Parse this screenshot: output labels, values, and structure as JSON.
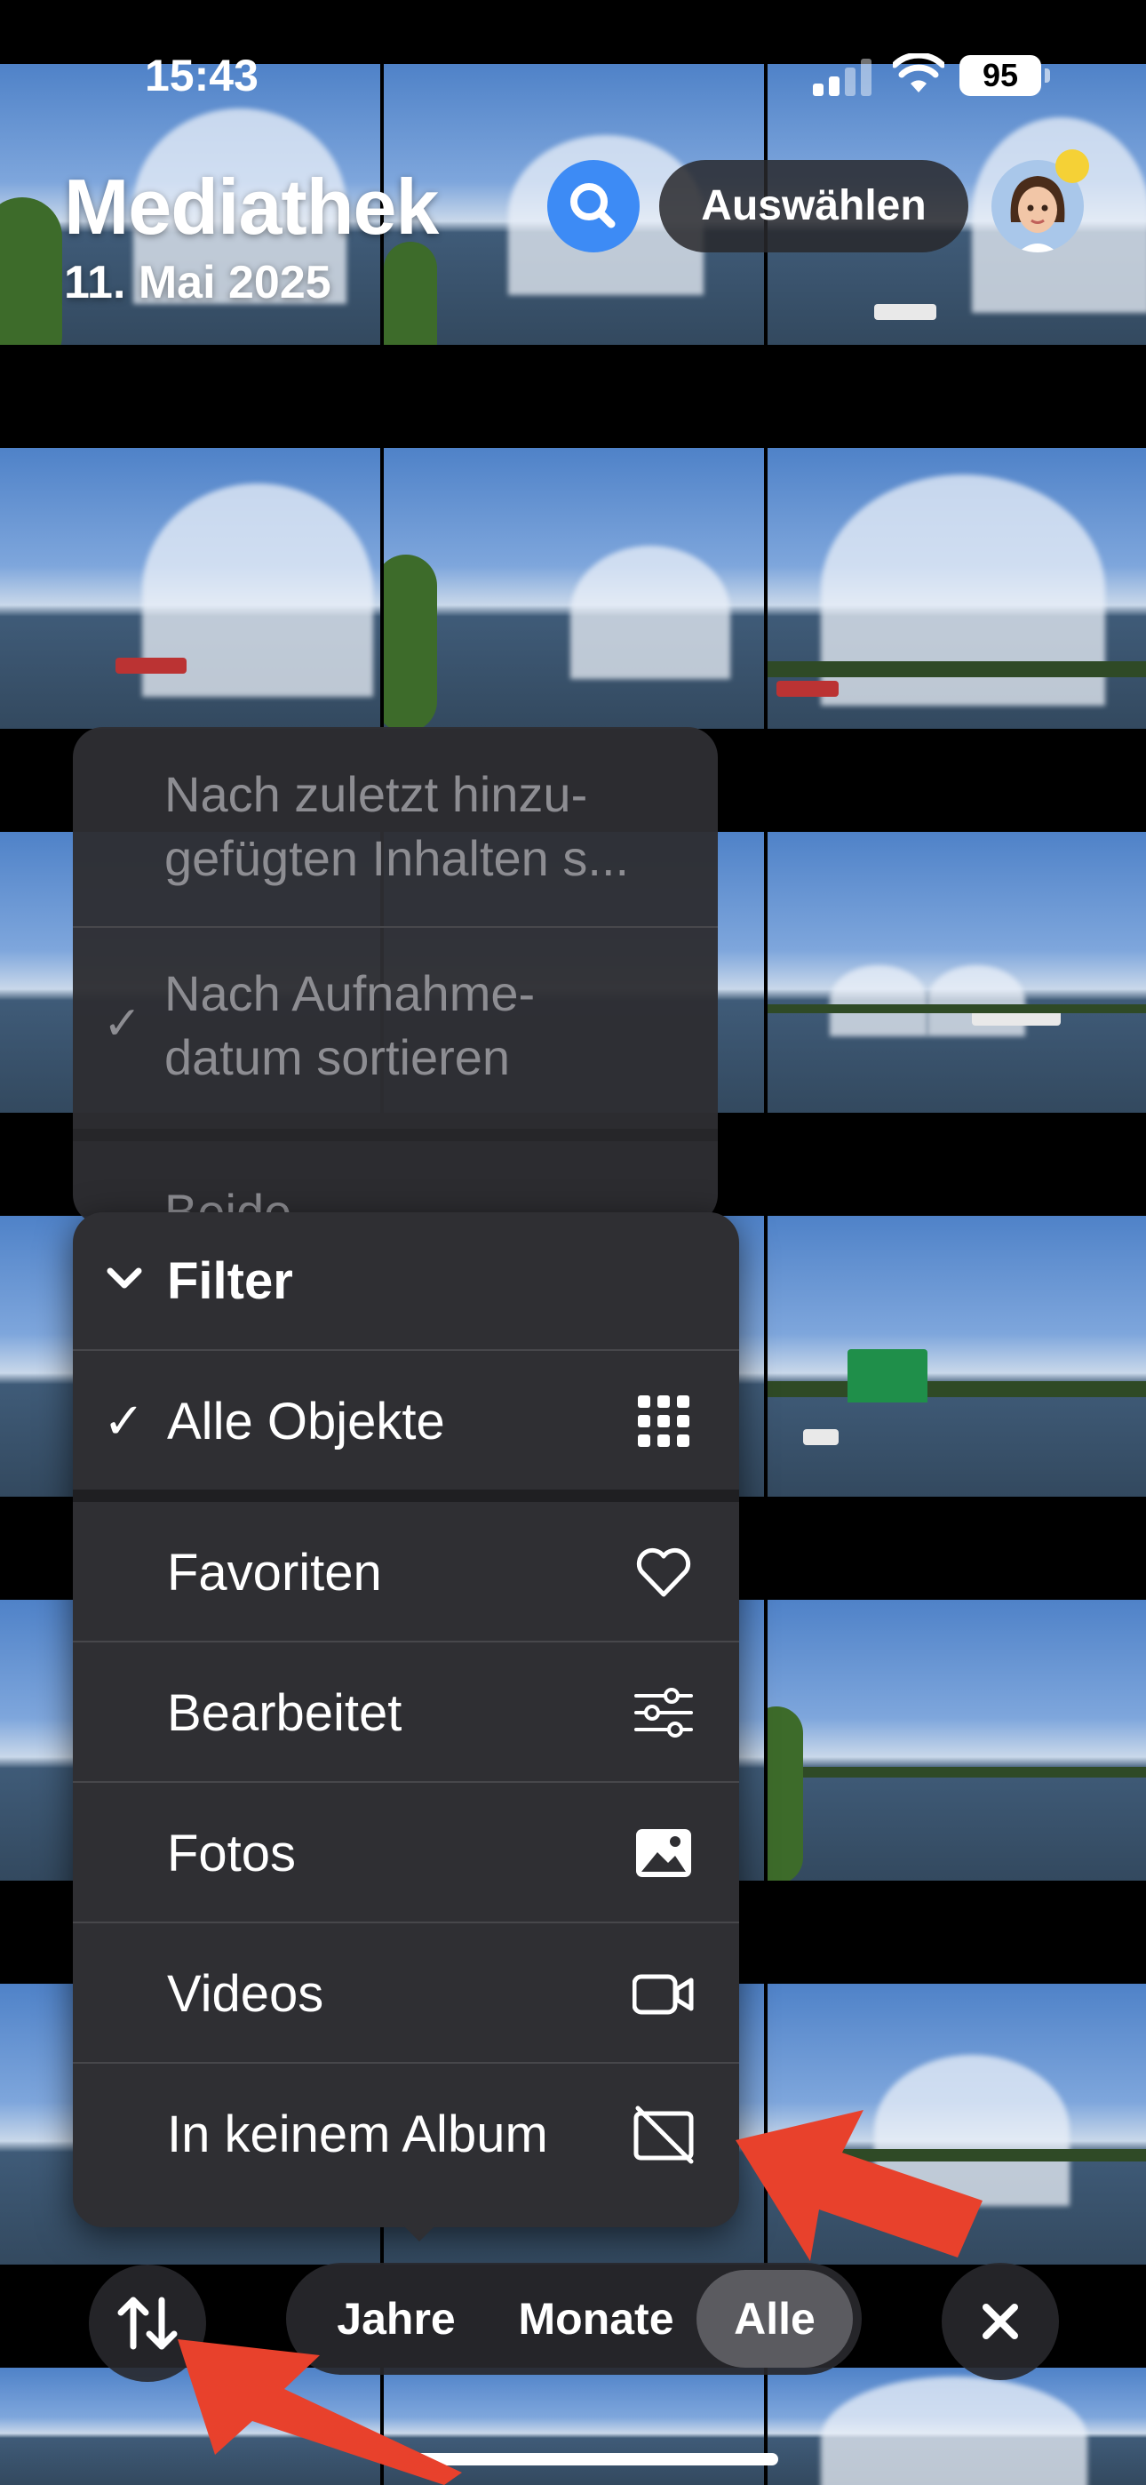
{
  "status_bar": {
    "time": "15:43",
    "battery": "95"
  },
  "header": {
    "title": "Mediathek",
    "date": "11. Mai 2025",
    "select_label": "Auswählen"
  },
  "sort_menu": {
    "items": [
      {
        "label_line1": "Nach zuletzt hinzu-",
        "label_line2": "gefügten Inhalten s...",
        "checked": false
      },
      {
        "label_line1": "Nach Aufnahme-",
        "label_line2": "datum sortieren",
        "checked": true
      },
      {
        "label_line1": "Beide",
        "label_line2": "",
        "checked": false
      }
    ],
    "check_glyph": "✓"
  },
  "filter_menu": {
    "header": "Filter",
    "items": [
      {
        "label": "Alle Objekte",
        "icon": "grid-icon",
        "checked": true
      },
      {
        "label": "Favoriten",
        "icon": "heart-icon",
        "checked": false
      },
      {
        "label": "Bearbeitet",
        "icon": "sliders-icon",
        "checked": false
      },
      {
        "label": "Fotos",
        "icon": "photo-icon",
        "checked": false
      },
      {
        "label": "Videos",
        "icon": "video-icon",
        "checked": false
      },
      {
        "label": "In keinem Album",
        "icon": "no-album-icon",
        "checked": false
      }
    ],
    "check_glyph": "✓"
  },
  "bottom_bar": {
    "segments": [
      "Jahre",
      "Monate",
      "Alle"
    ],
    "active_segment": "Alle"
  },
  "colors": {
    "accent_blue": "#3d8bf5",
    "annotation_red": "#e8412c",
    "menu_bg": "#2f2f33"
  }
}
